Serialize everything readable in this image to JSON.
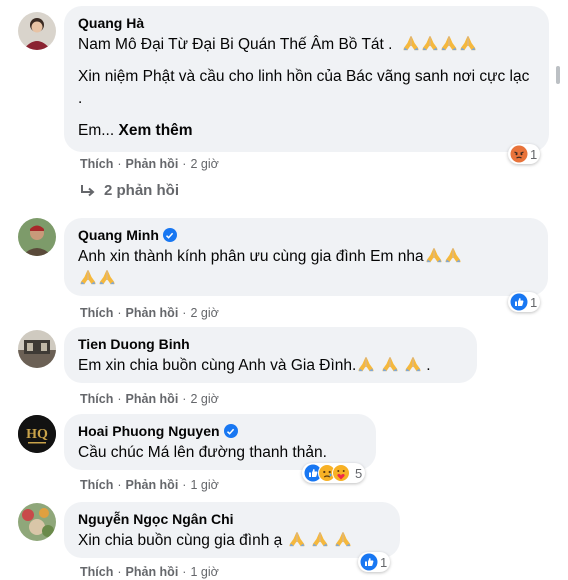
{
  "comments": [
    {
      "name": "Quang Hà",
      "lines": [
        "Nam Mô Đại Từ Đại Bi Quán Thế Âm Bồ Tát .",
        "Xin niệm Phật và cầu cho linh hồn của Bác vãng sanh nơi cực lạc .",
        "Em..."
      ],
      "see_more": "Xem thêm",
      "like": "Thích",
      "reply": "Phản hồi",
      "time": "2 giờ",
      "reaction_count": "1"
    },
    {
      "name": "Quang Minh",
      "text": "Anh xin thành kính phân ưu cùng gia đình Em nha",
      "like": "Thích",
      "reply": "Phản hồi",
      "time": "2 giờ",
      "reaction_count": "1"
    },
    {
      "name": "Tien Duong Binh",
      "text": "Em xin chia buồn cùng Anh và Gia Đình.",
      "like": "Thích",
      "reply": "Phản hồi",
      "time": "2 giờ"
    },
    {
      "name": "Hoai Phuong Nguyen",
      "text": "Cầu chúc Má lên đường thanh thản.",
      "like": "Thích",
      "reply": "Phản hồi",
      "time": "1 giờ",
      "reaction_count": "5"
    },
    {
      "name": "Nguyễn Ngọc Ngân Chi",
      "text": "Xin chia buồn cùng gia đình ạ",
      "like": "Thích",
      "reply": "Phản hồi",
      "time": "1 giờ",
      "reaction_count": "1"
    }
  ],
  "replies_link": "2 phản hồi",
  "avatar_logo_text": "HQ",
  "icons": [
    "verified-badge-icon",
    "folded-hands-emoji",
    "angry-reaction-icon",
    "like-reaction-icon",
    "care-reaction-icon",
    "reply-arrow-icon"
  ],
  "colors": {
    "bubble": "#f0f2f5",
    "meta": "#65676b",
    "blue": "#1877f2",
    "pray": "#f5b83d"
  }
}
